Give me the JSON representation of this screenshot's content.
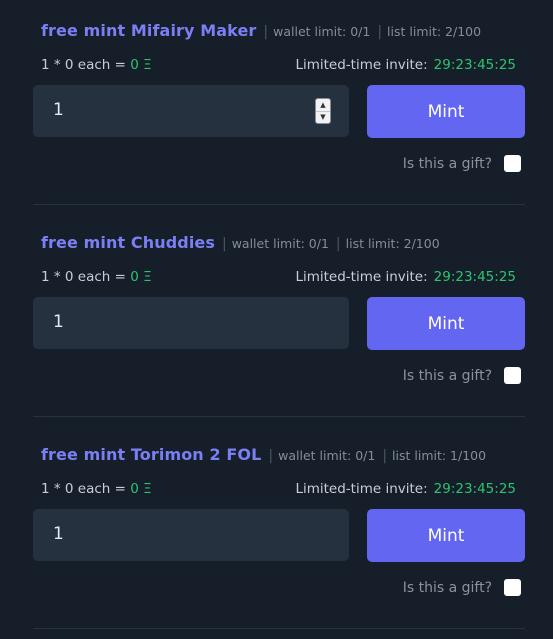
{
  "items": [
    {
      "title": "free mint Mifairy Maker",
      "wallet_limit": "wallet limit: 0/1",
      "list_limit": "list limit: 2/100",
      "price_prefix": "1 * 0 each = ",
      "price_value": "0 Ξ",
      "invite_label": "Limited-time invite:",
      "invite_timer": "29:23:45:25",
      "quantity": "1",
      "mint_label": "Mint",
      "gift_label": "Is this a gift?"
    },
    {
      "title": "free mint Chuddies",
      "wallet_limit": "wallet limit: 0/1",
      "list_limit": "list limit: 2/100",
      "price_prefix": "1 * 0 each = ",
      "price_value": "0 Ξ",
      "invite_label": "Limited-time invite:",
      "invite_timer": "29:23:45:25",
      "quantity": "1",
      "mint_label": "Mint",
      "gift_label": "Is this a gift?"
    },
    {
      "title": "free mint Torimon 2 FOL",
      "wallet_limit": "wallet limit: 0/1",
      "list_limit": "list limit: 1/100",
      "price_prefix": "1 * 0 each = ",
      "price_value": "0 Ξ",
      "invite_label": "Limited-time invite:",
      "invite_timer": "29:23:45:25",
      "quantity": "1",
      "mint_label": "Mint",
      "gift_label": "Is this a gift?"
    }
  ],
  "colors": {
    "background": "#161e29",
    "accent": "#6366f1",
    "title": "#7b7ff4",
    "positive": "#2cc56f"
  }
}
